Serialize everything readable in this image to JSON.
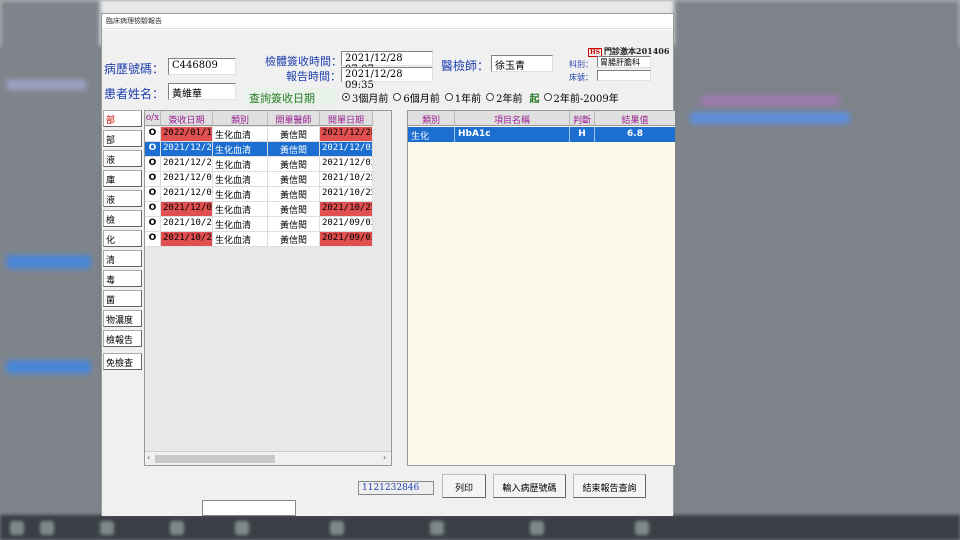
{
  "window": {
    "title": "臨床病理檢驗報告"
  },
  "header": {
    "chart_no_label": "病歷號碼：",
    "chart_no": "C446809",
    "patient_label": "患者姓名：",
    "patient_name": "黃維華",
    "recv_time_label": "檢體簽收時間：",
    "recv_time": "2021/12/28 07:07",
    "report_time_label": "報告時間：",
    "report_time": "2021/12/28 09:35",
    "doctor_label": "醫檢師：",
    "doctor": "徐玉青",
    "badge_hs": "HS",
    "badge_text": "門診激本201406",
    "dept_label": "科別：",
    "dept": "胃腸肝膽科",
    "bed_label": "床號：",
    "bed": ""
  },
  "query": {
    "label": "查詢簽收日期",
    "options": [
      "3個月前",
      "6個月前",
      "1年前",
      "2年前"
    ],
    "selected": "3個月前",
    "from_label": "起",
    "range_option": "2年前-2009年"
  },
  "side_buttons": [
    "部",
    "部",
    "液",
    "庫",
    "液",
    "檢",
    "化",
    "清",
    "毒",
    "菌",
    "物濃度",
    "檢報告",
    "免檢查"
  ],
  "left_table": {
    "headers": [
      "o/x",
      "簽收日期",
      "類別",
      "開單醫師",
      "開單日期"
    ],
    "rows": [
      {
        "ck": "O",
        "recv": "2022/01/19",
        "cat": "生化血清",
        "doc": "黃信閎",
        "order": "2021/12/28",
        "recv_red": true,
        "order_red": true
      },
      {
        "ck": "O",
        "recv": "2021/12/28",
        "cat": "生化血清",
        "doc": "黃信閎",
        "order": "2021/12/03",
        "selected": true
      },
      {
        "ck": "O",
        "recv": "2021/12/28",
        "cat": "生化血清",
        "doc": "黃信閎",
        "order": "2021/12/03"
      },
      {
        "ck": "O",
        "recv": "2021/12/01",
        "cat": "生化血清",
        "doc": "黃信閎",
        "order": "2021/10/25"
      },
      {
        "ck": "O",
        "recv": "2021/12/01",
        "cat": "生化血清",
        "doc": "黃信閎",
        "order": "2021/10/25"
      },
      {
        "ck": "O",
        "recv": "2021/12/01",
        "cat": "生化血清",
        "doc": "黃信閎",
        "order": "2021/10/25",
        "recv_red": true,
        "order_red": true
      },
      {
        "ck": "O",
        "recv": "2021/10/25",
        "cat": "生化血清",
        "doc": "黃信閎",
        "order": "2021/09/03"
      },
      {
        "ck": "O",
        "recv": "2021/10/25",
        "cat": "生化血清",
        "doc": "黃信閎",
        "order": "2021/09/03",
        "recv_red": true,
        "order_red": true
      }
    ]
  },
  "right_table": {
    "headers": [
      "類別",
      "項目名稱",
      "判斷",
      "結果值"
    ],
    "rows": [
      {
        "cat": "生化",
        "item": "HbA1c",
        "flag": "H",
        "value": "6.8"
      }
    ]
  },
  "footer": {
    "code": "1121232846",
    "print": "列印",
    "input_chart": "輸入病歷號碼",
    "end_query": "結束報告查詢"
  },
  "colors": {
    "selected": "#1c6fd0",
    "highlight_red": "#e05050",
    "label_blue": "#1f3fae",
    "header_purple": "#9a2090"
  }
}
